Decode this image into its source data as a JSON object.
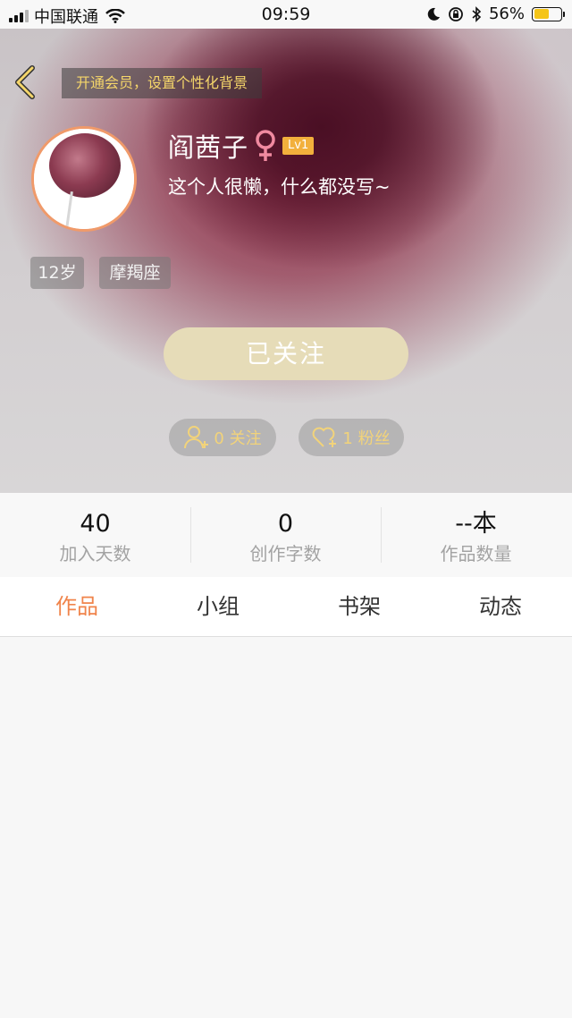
{
  "status_bar": {
    "carrier": "中国联通",
    "time": "09:59",
    "battery_percent": "56%",
    "battery_level": 0.56,
    "signal_bars_active": 3,
    "signal_bars_total": 4
  },
  "header": {
    "vip_banner": "开通会员，设置个性化背景",
    "user_name": "阎茜子",
    "level": "Lv1",
    "bio": "这个人很懒，什么都没写~",
    "tags": [
      "12岁",
      "摩羯座"
    ],
    "follow_button": "已关注",
    "following": "0 关注",
    "fans": "1 粉丝",
    "colors": {
      "accent": "#f2d37a",
      "avatar_border": "#f09a6a",
      "follow_button_bg": "#e6dcb8"
    }
  },
  "stats": [
    {
      "value": "40",
      "label": "加入天数"
    },
    {
      "value": "0",
      "label": "创作字数"
    },
    {
      "value": "--本",
      "label": "作品数量"
    }
  ],
  "tabs": [
    {
      "label": "作品",
      "active": true
    },
    {
      "label": "小组",
      "active": false
    },
    {
      "label": "书架",
      "active": false
    },
    {
      "label": "动态",
      "active": false
    }
  ],
  "icons": {
    "back": "chevron-left-icon",
    "gender": "female-icon",
    "following": "add-user-icon",
    "fans": "heart-plus-icon",
    "status": [
      "signal-icon",
      "wifi-icon",
      "moon-icon",
      "rotation-lock-icon",
      "bluetooth-icon",
      "battery-icon"
    ]
  },
  "tab_active_color": "#f0844b"
}
